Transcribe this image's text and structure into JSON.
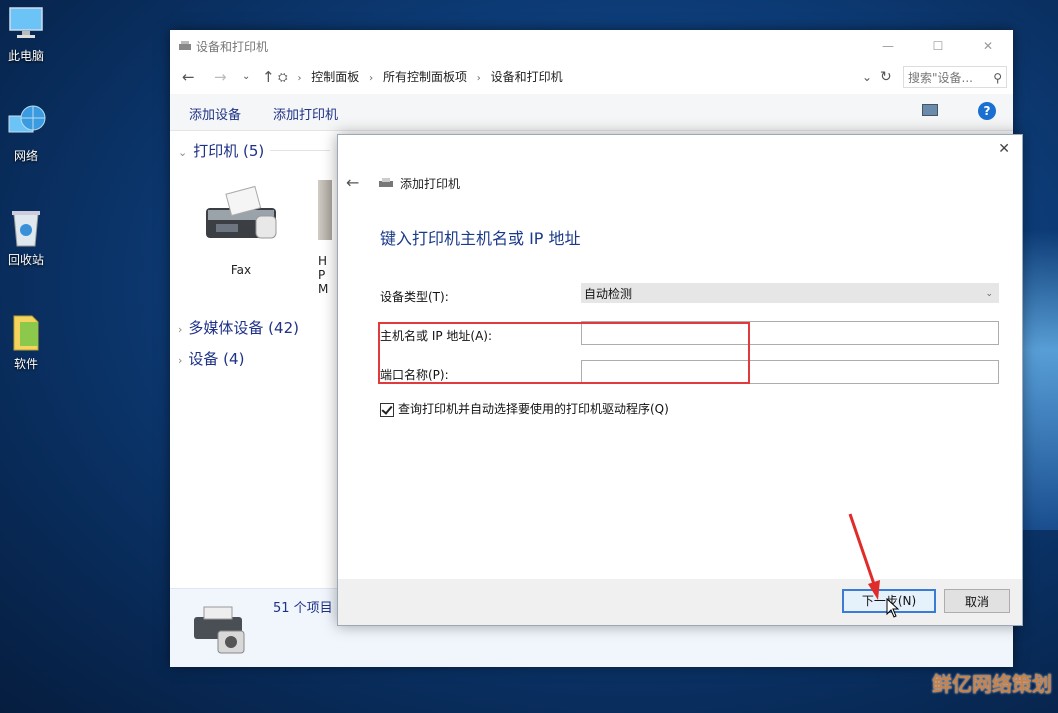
{
  "desktop": {
    "icons": [
      {
        "label": "此电脑"
      },
      {
        "label": "网络"
      },
      {
        "label": "回收站"
      },
      {
        "label": "软件"
      }
    ]
  },
  "explorer": {
    "title": "设备和打印机",
    "breadcrumbs": [
      "控制面板",
      "所有控制面板项",
      "设备和打印机"
    ],
    "search_placeholder": "搜索\"设备...",
    "toolbar": {
      "add_device": "添加设备",
      "add_printer": "添加打印机"
    },
    "groups": [
      {
        "label": "打印机 (5)"
      },
      {
        "label": "多媒体设备 (42)"
      },
      {
        "label": "设备 (4)"
      }
    ],
    "devices": [
      {
        "label": "Fax"
      },
      {
        "label": "H"
      },
      {
        "label": "P"
      },
      {
        "label": "M"
      }
    ],
    "status": {
      "count": "51 个项目"
    }
  },
  "dialog": {
    "title": "添加打印机",
    "heading": "键入打印机主机名或 IP 地址",
    "device_type_label": "设备类型(T):",
    "device_type_value": "自动检测",
    "hostname_label": "主机名或 IP 地址(A):",
    "hostname_value": "",
    "port_label": "端口名称(P):",
    "port_value": "",
    "query_checkbox_label": "查询打印机并自动选择要使用的打印机驱动程序(Q)",
    "next_button": "下一步(N)",
    "cancel_button": "取消"
  },
  "watermark": "鲜亿网络策划"
}
